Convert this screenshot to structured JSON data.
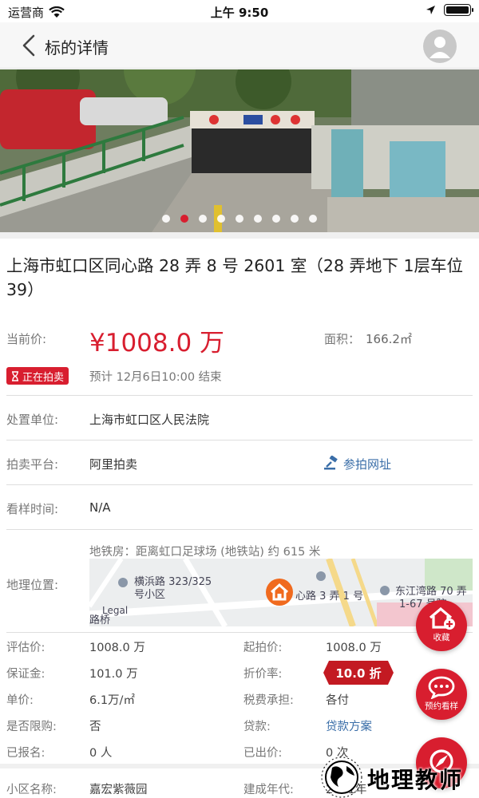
{
  "status_bar": {
    "carrier": "运营商",
    "time": "上午 9:50"
  },
  "nav": {
    "title": "标的详情"
  },
  "banner": {
    "dot_count": 9,
    "active_dot": 1
  },
  "title": "上海市虹口区同心路 28 弄 8 号 2601 室（28 弄地下 1层车位 39）",
  "price": {
    "label": "当前价:",
    "value": "¥1008.0 万",
    "area_label": "面积：",
    "area_value": "166.2㎡"
  },
  "status": {
    "badge": "正在拍卖",
    "end_time": "预计 12月6日10:00 结束"
  },
  "disposal": {
    "label": "处置单位:",
    "value": "上海市虹口区人民法院"
  },
  "platform": {
    "label": "拍卖平台:",
    "value": "阿里拍卖",
    "link": "参拍网址"
  },
  "viewing": {
    "label": "看样时间:",
    "value": "N/A"
  },
  "location": {
    "label": "地理位置:",
    "metro": "地铁房：距离虹口足球场 (地铁站) 约 615 米",
    "map_labels": {
      "poi1": "横浜路 323/325",
      "poi1b": "号小区",
      "poi2": "心路 3 弄 1 号",
      "poi3": "东江湾路 70 弄",
      "poi3b": "1-67 号院",
      "road": "路桥",
      "legal": "Legal"
    }
  },
  "info": {
    "assess_label": "评估价:",
    "assess_value": "1008.0 万",
    "start_label": "起拍价:",
    "start_value": "1008.0 万",
    "deposit_label": "保证金:",
    "deposit_value": "101.0 万",
    "discount_label": "折价率:",
    "discount_value": "10.0 折",
    "unit_label": "单价:",
    "unit_value": "6.1万/㎡",
    "tax_label": "税费承担:",
    "tax_value": "各付",
    "limit_label": "是否限购:",
    "limit_value": "否",
    "loan_label": "贷款:",
    "loan_value": "贷款方案",
    "signup_label": "已报名:",
    "signup_value": "0 人",
    "bid_label": "已出价:",
    "bid_value": "0 次",
    "community_label": "小区名称:",
    "community_value": "嘉宏紫薇园",
    "year_label": "建成年代:",
    "year_value": "2001年"
  },
  "fabs": {
    "favorite": "收藏",
    "appointment": "预约看样"
  },
  "watermark": {
    "text": "地理教师"
  },
  "colors": {
    "accent": "#d81e2f",
    "link": "#3a6ea8"
  }
}
